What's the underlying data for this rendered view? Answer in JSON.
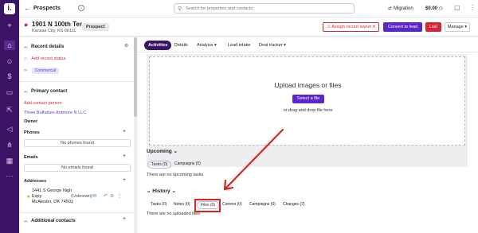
{
  "app": {
    "logo_letter": "i."
  },
  "topbar": {
    "breadcrumb": "Prospects",
    "search_placeholder": "Search for properties and contacts",
    "migration_label": "Migration",
    "balance": "$0.00"
  },
  "record": {
    "address_line1": "1901 N 100th Ter",
    "address_line2": "Kansas City, KS 66111",
    "status_tag": "Prospect",
    "assign_label": "Assign record owner",
    "convert_label": "Convert to lead",
    "lost_label": "Lost",
    "manage_label": "Manage"
  },
  "left": {
    "record_details_title": "Record details",
    "add_status_label": "Add record status",
    "category_tag": "Commercial",
    "primary_contact_title": "Primary contact",
    "add_contact_label": "Add contact person",
    "company_name": "Three Buffaloes Ardmore N LLC",
    "owner_label": "Owner",
    "phones_label": "Phones",
    "no_phones": "No phones found",
    "emails_label": "Emails",
    "no_emails": "No emails found",
    "addresses_label": "Addresses",
    "address_line1": "1441 S George Nigh",
    "address_line2": "Expy",
    "address_type": "(Unknown)",
    "address_line3": "McAlester, OK 74501",
    "additional_contacts_title": "Additional contacts"
  },
  "tabs": [
    "Activities",
    "Details",
    "Analysis",
    "Lead intake",
    "Deal tracker"
  ],
  "upload": {
    "title": "Upload images or files",
    "button": "Select a file",
    "subtitle": "or drag and drop file here"
  },
  "upcoming": {
    "title": "Upcoming",
    "tabs": [
      "Tasks (0)",
      "Campaigns (0)"
    ],
    "empty": "There are no upcoming tasks"
  },
  "history": {
    "title": "History",
    "tabs": [
      "Tasks (0)",
      "Notes (0)",
      "Files (0)",
      "Comms (0)",
      "Campaigns (0)",
      "Changes (2)"
    ],
    "empty": "There are no uploaded files"
  },
  "colors": {
    "brand": "#3b1466",
    "accent": "#5b27c9",
    "danger": "#d62739",
    "annotation": "#d8261c"
  }
}
